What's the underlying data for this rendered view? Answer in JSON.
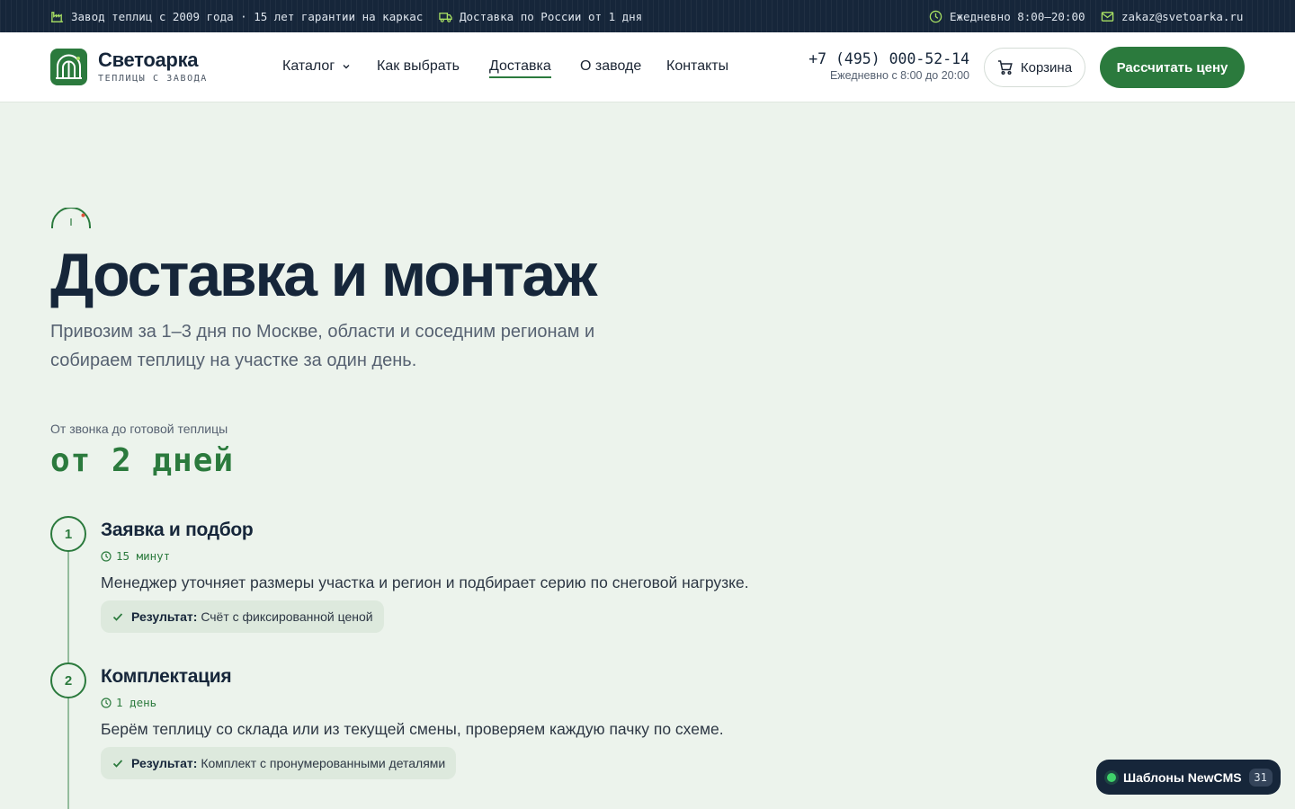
{
  "topbar": {
    "factory_text": "Завод теплиц с 2009 года · 15 лет гарантии на каркас",
    "delivery_text": "Доставка по России от 1 дня",
    "hours_text": "Ежедневно 8:00–20:00",
    "email": "zakaz@svetoarka.ru",
    "accent_color": "#a8e063"
  },
  "header": {
    "logo_name": "Светоарка",
    "logo_sub": "ТЕПЛИЦЫ С ЗАВОДА",
    "nav": [
      {
        "label": "Каталог",
        "has_dropdown": true,
        "active": false
      },
      {
        "label": "Как выбрать",
        "active": false
      },
      {
        "label": "Доставка",
        "active": true
      },
      {
        "label": "О заводе",
        "active": false
      },
      {
        "label": "Контакты",
        "active": false
      }
    ],
    "phone": "+7 (495) 000-52-14",
    "phone_hours": "Ежедневно с 8:00 до 20:00",
    "cart_label": "Корзина",
    "cta_label": "Рассчитать цену"
  },
  "hero": {
    "title": "Доставка и монтаж",
    "subtitle": "Привозим за 1–3 дня по Москве, области и соседним регионам и собираем теплицу на участке за один день.",
    "stat_label": "От звонка до готовой теплицы",
    "stat_value": "от 2 дней"
  },
  "steps": [
    {
      "number": "1",
      "title": "Заявка и подбор",
      "time": "15 минут",
      "description": "Менеджер уточняет размеры участка и регион и подбирает серию по снеговой нагрузке.",
      "result_label": "Результат:",
      "result_text": "Счёт с фиксированной ценой"
    },
    {
      "number": "2",
      "title": "Комплектация",
      "time": "1 день",
      "description": "Берём теплицу со склада или из текущей смены, проверяем каждую пачку по схеме.",
      "result_label": "Результат:",
      "result_text": "Комплект с пронумерованными деталями"
    }
  ],
  "badge": {
    "label": "Шаблоны NewCMS",
    "count": "31"
  },
  "colors": {
    "brand_green": "#2b7a3d",
    "dark_navy": "#16263a",
    "page_bg": "#ecf3ec"
  }
}
